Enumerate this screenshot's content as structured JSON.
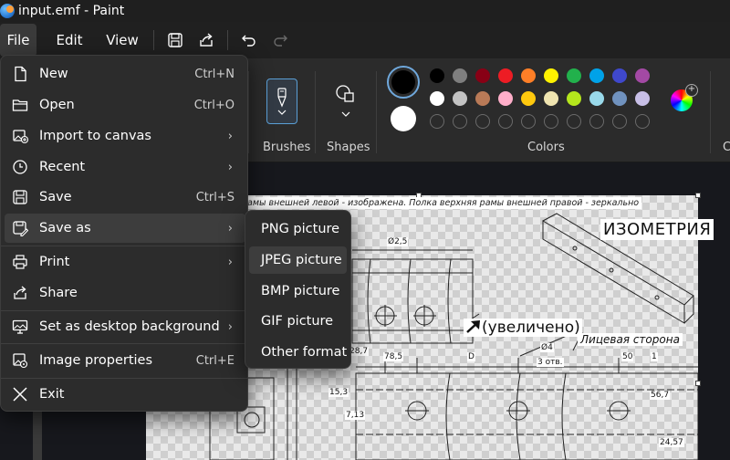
{
  "window": {
    "title": "input.emf - Paint"
  },
  "menubar": {
    "file": "File",
    "edit": "Edit",
    "view": "View"
  },
  "toolbar_icons": [
    "save-icon",
    "share-icon",
    "undo-icon",
    "redo-icon"
  ],
  "ribbon": {
    "brushes_label": "Brushes",
    "shapes_label": "Shapes",
    "colors_label": "Colors",
    "primary_color": "#000000",
    "secondary_color": "#ffffff",
    "palette": [
      "#000000",
      "#7f7f7f",
      "#880015",
      "#ed1c24",
      "#ff7f27",
      "#fff200",
      "#22b14c",
      "#00a2e8",
      "#3f48cc",
      "#a349a4",
      "#ffffff",
      "#c3c3c3",
      "#b97a57",
      "#ffaec9",
      "#ffc90e",
      "#efe4b0",
      "#b5e61d",
      "#99d9ea",
      "#7092be",
      "#c8bfe7",
      "",
      "",
      "",
      "",
      "",
      "",
      "",
      "",
      "",
      ""
    ]
  },
  "file_menu": {
    "items": [
      {
        "label": "New",
        "shortcut": "Ctrl+N",
        "icon": "new-file-icon"
      },
      {
        "label": "Open",
        "shortcut": "Ctrl+O",
        "icon": "folder-icon"
      },
      {
        "label": "Import to canvas",
        "shortcut": "",
        "icon": "import-image-icon",
        "submenu": true
      },
      {
        "label": "Recent",
        "shortcut": "",
        "icon": "clock-icon",
        "submenu": true
      },
      {
        "label": "Save",
        "shortcut": "Ctrl+S",
        "icon": "save-icon"
      },
      {
        "label": "Save as",
        "shortcut": "",
        "icon": "save-as-icon",
        "submenu": true
      },
      {
        "label": "Print",
        "shortcut": "",
        "icon": "printer-icon",
        "submenu": true
      },
      {
        "label": "Share",
        "shortcut": "",
        "icon": "share-icon"
      },
      {
        "label": "Set as desktop background",
        "shortcut": "",
        "icon": "desktop-background-icon",
        "submenu": true
      },
      {
        "label": "Image properties",
        "shortcut": "Ctrl+E",
        "icon": "image-properties-icon"
      },
      {
        "label": "Exit",
        "shortcut": "",
        "icon": "close-icon"
      }
    ]
  },
  "save_as_menu": {
    "items": [
      "PNG picture",
      "JPEG picture",
      "BMP picture",
      "GIF picture",
      "Other format"
    ]
  },
  "canvas": {
    "caption": "амы внешней левой - изображена. Полка верхняя рамы внешней правой - зеркально",
    "isometry": "ИЗОМЕТРИЯ",
    "enlarged": "(увеличено)",
    "face_side": "Лицевая сторона",
    "dims": [
      "Ø2,5",
      "78,5",
      "D",
      "Ø4",
      "3 отв.",
      "50",
      "1",
      "15,3",
      "7,13",
      "56,7",
      "24,57",
      "28,7"
    ]
  }
}
